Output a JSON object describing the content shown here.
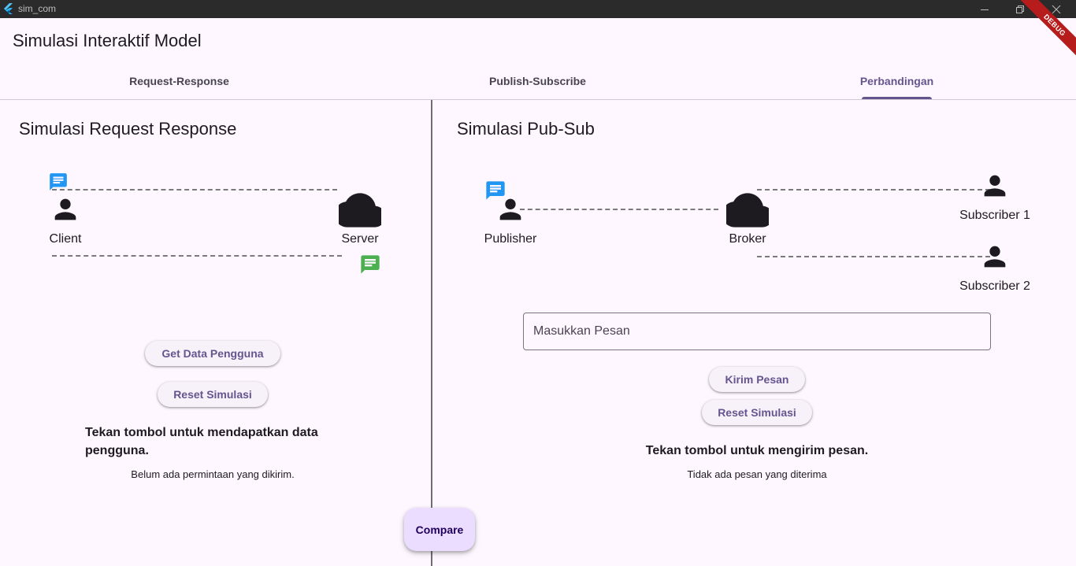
{
  "window": {
    "title": "sim_com",
    "debug_banner": "DEBUG"
  },
  "appbar": {
    "title": "Simulasi Interaktif Model"
  },
  "tabs": [
    {
      "label": "Request-Response",
      "active": false
    },
    {
      "label": "Publish-Subscribe",
      "active": false
    },
    {
      "label": "Perbandingan",
      "active": true
    }
  ],
  "request_response": {
    "title": "Simulasi Request Response",
    "client_label": "Client",
    "server_label": "Server",
    "get_data_button": "Get Data Pengguna",
    "reset_button": "Reset Simulasi",
    "instruction": "Tekan tombol untuk mendapatkan data pengguna.",
    "status": "Belum ada permintaan yang dikirim."
  },
  "pub_sub": {
    "title": "Simulasi Pub-Sub",
    "publisher_label": "Publisher",
    "broker_label": "Broker",
    "subscriber1_label": "Subscriber 1",
    "subscriber2_label": "Subscriber 2",
    "message_placeholder": "Masukkan Pesan",
    "send_button": "Kirim Pesan",
    "reset_button": "Reset Simulasi",
    "instruction": "Tekan tombol untuk mengirim pesan.",
    "status": "Tidak ada pesan yang diterima"
  },
  "fab": {
    "label": "Compare"
  },
  "colors": {
    "accent": "#65558f",
    "message_blue": "#2196f3",
    "message_green": "#4caf50",
    "background": "#fef7ff"
  }
}
